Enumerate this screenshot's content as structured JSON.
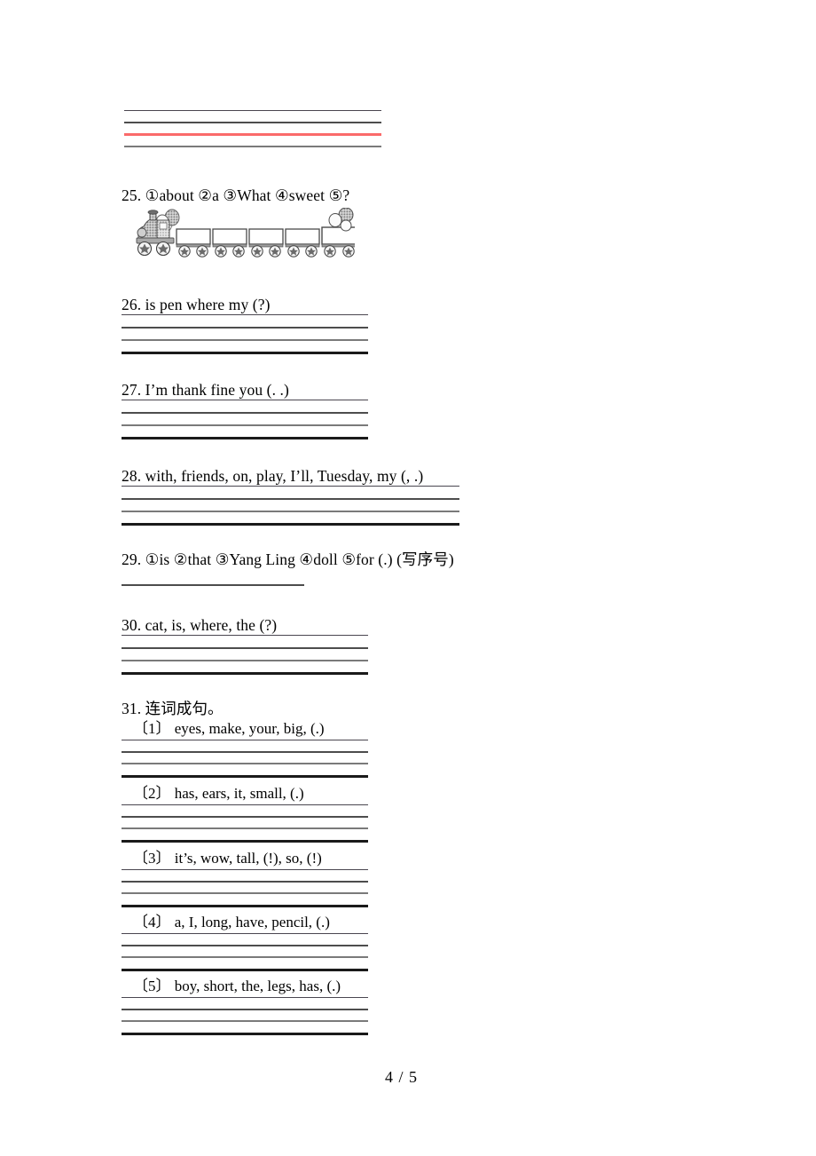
{
  "document": {
    "page_label": "4 / 5",
    "top_lines": {
      "count": 4,
      "accent_color": "#fa6a6a",
      "accent_line_index": 3
    }
  },
  "questions": [
    {
      "id": "q25",
      "number": "25.",
      "text": "25. ①about ②a ③What ④sweet ⑤?",
      "has_image": true,
      "image_name": "train-with-five-wagons",
      "answer_lines": 0
    },
    {
      "id": "q26",
      "number": "26.",
      "text": "26. is pen where my (?)",
      "has_image": false,
      "answer_lines": 4
    },
    {
      "id": "q27",
      "number": "27.",
      "text": "27. I’m  thank  fine  you (. .)",
      "has_image": false,
      "answer_lines": 4
    },
    {
      "id": "q28",
      "number": "28.",
      "text": "28. with, friends, on, play, I’ll, Tuesday, my (, .)",
      "has_image": false,
      "answer_lines": 4
    },
    {
      "id": "q29",
      "number": "29.",
      "text": "29. ①is ②that ③Yang Ling ④doll ⑤for (.) (写序号)",
      "has_image": false,
      "answer_lines": 1
    },
    {
      "id": "q30",
      "number": "30.",
      "text": "30. cat, is, where, the (?)",
      "has_image": false,
      "answer_lines": 4
    },
    {
      "id": "q31",
      "number": "31.",
      "text": "31. 连词成句。",
      "has_image": false,
      "answer_lines": 0,
      "sub_items": [
        {
          "id": "q31-1",
          "text": "〔1〕 eyes, make, your, big, (.)",
          "answer_lines": 4
        },
        {
          "id": "q31-2",
          "text": "〔2〕 has, ears, it, small, (.)",
          "answer_lines": 4
        },
        {
          "id": "q31-3",
          "text": "〔3〕 it’s, wow, tall, (!), so, (!)",
          "answer_lines": 4
        },
        {
          "id": "q31-4",
          "text": "〔4〕 a, I, long, have, pencil, (.)",
          "answer_lines": 4
        },
        {
          "id": "q31-5",
          "text": "〔5〕 boy, short, the, legs, has, (.)",
          "answer_lines": 4
        }
      ]
    }
  ]
}
